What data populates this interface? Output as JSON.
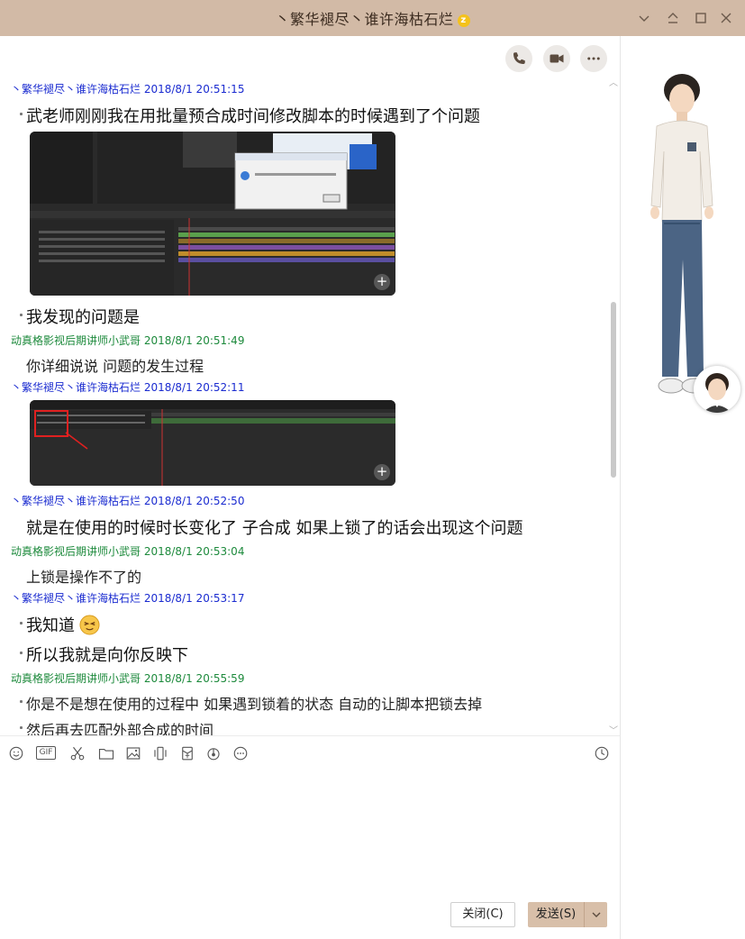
{
  "window": {
    "title": "丶繁华褪尽丶谁许海枯石烂",
    "title_badge": "z",
    "controls": [
      "chevron-down-icon",
      "pin-icon",
      "maximize-icon",
      "close-icon"
    ]
  },
  "header_actions": [
    "phone-icon",
    "video-icon",
    "more-icon"
  ],
  "messages": [
    {
      "sender": "丶繁华褪尽丶谁许海枯石烂",
      "time": "2018/8/1 20:51:15",
      "color": "#1a2bd0",
      "lines": [
        "武老师刚刚我在用批量预合成时间修改脚本的时候遇到了个问题"
      ]
    },
    {
      "sender": "",
      "time": "",
      "lines": [
        "我发现的问题是"
      ]
    },
    {
      "sender": "动真格影视后期讲师小武哥",
      "time": "2018/8/1 20:51:49",
      "color": "#1d8a3c",
      "lines": [
        "你详细说说 问题的发生过程"
      ]
    },
    {
      "sender": "丶繁华褪尽丶谁许海枯石烂",
      "time": "2018/8/1 20:52:11",
      "color": "#1a2bd0",
      "lines": []
    },
    {
      "sender": "丶繁华褪尽丶谁许海枯石烂",
      "time": "2018/8/1 20:52:50",
      "color": "#1a2bd0",
      "lines": [
        "就是在使用的时候时长变化了 子合成 如果上锁了的话会出现这个问题"
      ]
    },
    {
      "sender": "动真格影视后期讲师小武哥",
      "time": "2018/8/1 20:53:04",
      "color": "#1d8a3c",
      "lines": [
        "上锁是操作不了的"
      ]
    },
    {
      "sender": "丶繁华褪尽丶谁许海枯石烂",
      "time": "2018/8/1 20:53:17",
      "color": "#1a2bd0",
      "lines": [
        "我知道",
        "所以我就是向你反映下"
      ]
    },
    {
      "sender": "动真格影视后期讲师小武哥",
      "time": "2018/8/1 20:55:59",
      "color": "#1d8a3c",
      "lines": [
        "你是不是想在使用的过程中 如果遇到锁着的状态 自动的让脚本把锁去掉",
        "然后再去匹配外部合成的时间"
      ]
    }
  ],
  "toolbar": {
    "gif_label": "GIF",
    "icons": [
      "emoji-icon",
      "gif-icon",
      "scissors-icon",
      "folder-icon",
      "image-icon",
      "shake-icon",
      "red-packet-icon",
      "music-icon",
      "more-icon",
      "history-icon"
    ]
  },
  "buttons": {
    "close_label": "关闭(C)",
    "send_label": "发送(S)"
  },
  "colors": {
    "titlebar": "#d2baa6",
    "send": "#d8bfa9",
    "blue_name": "#1a2bd0",
    "green_name": "#1d8a3c"
  }
}
